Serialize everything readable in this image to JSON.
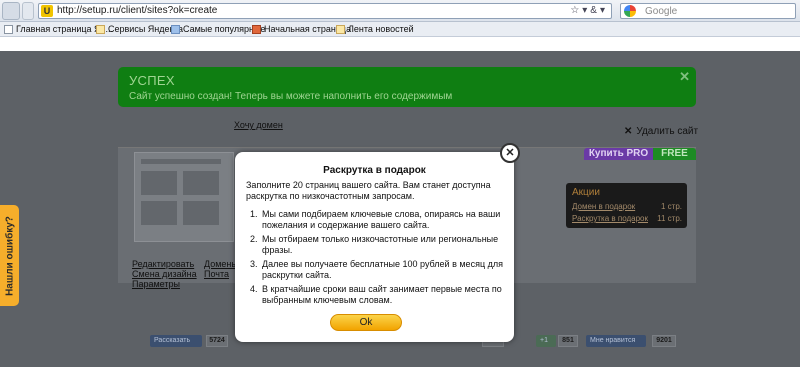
{
  "browser": {
    "url": "http://setup.ru/client/sites?ok=create",
    "search_placeholder": "Google",
    "bookmarks": [
      "Главная страница Ян...",
      "Сервисы Яндекса",
      "Самые популярные",
      "Начальная страница",
      "Лента новостей"
    ]
  },
  "page": {
    "success_title": "УСПЕХ",
    "success_text": "Сайт успешно создан! Теперь вы можете наполнить его содержимым",
    "success_close": "✕",
    "want_domain": "Хочу домен",
    "delete_site": "Удалить сайт",
    "tab_pro": "Купить PRO",
    "tab_free": "FREE",
    "promo": {
      "title": "Акции",
      "rows": [
        {
          "label": "Домен в подарок",
          "value": "1 стр."
        },
        {
          "label": "Раскрутка в подарок",
          "value": "11 стр."
        }
      ]
    },
    "links_left": [
      "Редактировать",
      "Смена дизайна",
      "Параметры"
    ],
    "links_right": [
      "Домены",
      "Почта"
    ],
    "social": {
      "share_label": "Рассказать",
      "share_count": "5724",
      "count_mid": "010",
      "plus_label": "+1",
      "plus_count": "851",
      "like_label": "Мне нравится",
      "like_count": "9201"
    },
    "side_tab": "Нашли ошибку?"
  },
  "modal": {
    "title": "Раскрутка в подарок",
    "intro": "Заполните 20 страниц вашего сайта. Вам станет доступна раскрутка по низкочастотным запросам.",
    "items": [
      "Мы сами подбираем ключевые слова, опираясь на ваши пожелания и содержание вашего сайта.",
      "Мы отбираем только низкочастотные или региональные фразы.",
      "Далее вы получаете бесплатные 100 рублей в месяц для раскрутки сайта.",
      "В кратчайшие сроки ваш сайт занимает первые места по выбранным ключевым словам."
    ],
    "ok_label": "Ok",
    "close_label": "✕"
  }
}
